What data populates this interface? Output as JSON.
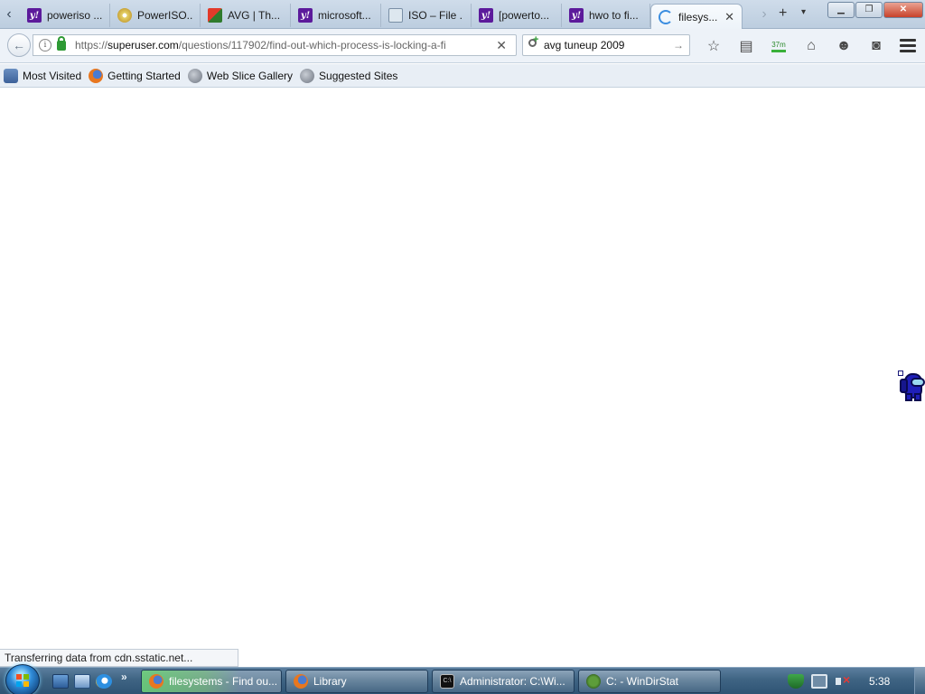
{
  "tabs": [
    {
      "title": "poweriso ...",
      "favicon": "yahoo-icon"
    },
    {
      "title": "PowerISO...",
      "favicon": "cd-icon"
    },
    {
      "title": "AVG | Th...",
      "favicon": "avg-icon"
    },
    {
      "title": "microsoft...",
      "favicon": "yahoo-icon"
    },
    {
      "title": "ISO – File ...",
      "favicon": "document-icon"
    },
    {
      "title": "[powerto...",
      "favicon": "yahoo-icon"
    },
    {
      "title": "hwo to fi...",
      "favicon": "yahoo-icon"
    },
    {
      "title": "filesys...",
      "favicon": "loading-spinner-icon",
      "active": true
    }
  ],
  "tab_icon_text": {
    "yahoo": "y!"
  },
  "navbar": {
    "url_prefix": "https://",
    "url_domain": "superuser.com",
    "url_path": "/questions/117902/find-out-which-process-is-locking-a-fi",
    "search_value": "avg tuneup 2009",
    "memory_indicator": "37m"
  },
  "bookmarks": [
    {
      "label": "Most Visited",
      "icon": "most-visited-icon"
    },
    {
      "label": "Getting Started",
      "icon": "firefox-icon"
    },
    {
      "label": "Web Slice Gallery",
      "icon": "globe-icon"
    },
    {
      "label": "Suggested Sites",
      "icon": "globe-icon"
    }
  ],
  "status_text": "Transferring data from cdn.sstatic.net...",
  "taskbar": {
    "tasks": [
      {
        "label": "filesystems - Find ou...",
        "icon": "firefox-icon",
        "active": true
      },
      {
        "label": "Library",
        "icon": "firefox-icon"
      },
      {
        "label": "Administrator: C:\\Wi...",
        "icon": "cmd-icon"
      },
      {
        "label": "C: - WinDirStat",
        "icon": "windirstat-icon"
      }
    ],
    "clock": "5:38"
  },
  "colors": {
    "tab_strip": "#c4d3e3",
    "taskbar": "#3f6483",
    "active_task_highlight": "#7ee67e",
    "secure_lock": "#2e9a34"
  }
}
